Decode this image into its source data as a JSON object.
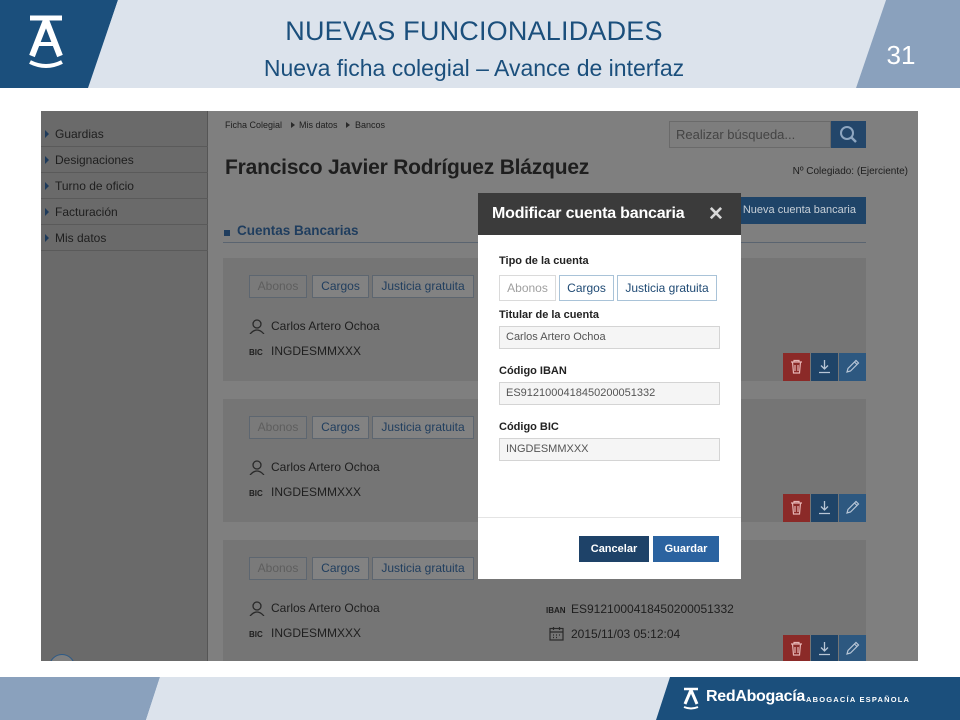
{
  "slide": {
    "title": "NUEVAS FUNCIONALIDADES",
    "subtitle": "Nueva ficha colegial – Avance de interfaz",
    "number": "31"
  },
  "footer": {
    "brand": "RedAbogacía",
    "brand_sub": "ABOGACÍA ESPAÑOLA"
  },
  "sidebar": {
    "items": [
      {
        "label": "Guardias"
      },
      {
        "label": "Designaciones"
      },
      {
        "label": "Turno de oficio"
      },
      {
        "label": "Facturación"
      },
      {
        "label": "Mis datos"
      }
    ]
  },
  "breadcrumb": [
    "Ficha Colegial",
    "Mis datos",
    "Bancos"
  ],
  "search": {
    "placeholder": "Realizar búsqueda..."
  },
  "profile": {
    "name": "Francisco Javier Rodríguez Blázquez",
    "colegiado": "Nº Colegiado: (Ejerciente)"
  },
  "new_account_button": "Nueva cuenta bancaria",
  "section_title": "Cuentas Bancarias",
  "cards": [
    {
      "tabs": [
        "Abonos",
        "Cargos",
        "Justicia gratuita"
      ],
      "holder": "Carlos Artero Ochoa",
      "bic_label": "BIC",
      "bic": "INGDESMMXXX"
    },
    {
      "tabs": [
        "Abonos",
        "Cargos",
        "Justicia gratuita"
      ],
      "holder": "Carlos Artero Ochoa",
      "bic_label": "BIC",
      "bic": "INGDESMMXXX"
    },
    {
      "tabs": [
        "Abonos",
        "Cargos",
        "Justicia gratuita"
      ],
      "holder": "Carlos Artero Ochoa",
      "bic_label": "BIC",
      "bic": "INGDESMMXXX",
      "iban_label": "IBAN",
      "iban": "ES9121000418450200051332",
      "date": "2015/11/03 05:12:04"
    }
  ],
  "modal": {
    "title": "Modificar cuenta bancaria",
    "close": "✕",
    "type_label": "Tipo de la cuenta",
    "tabs": [
      "Abonos",
      "Cargos",
      "Justicia gratuita"
    ],
    "holder_label": "Titular de la cuenta",
    "holder_value": "Carlos Artero Ochoa",
    "iban_label": "Código IBAN",
    "iban_value": "ES9121000418450200051332",
    "bic_label": "Código BIC",
    "bic_value": "INGDESMMXXX",
    "cancel": "Cancelar",
    "save": "Guardar"
  }
}
